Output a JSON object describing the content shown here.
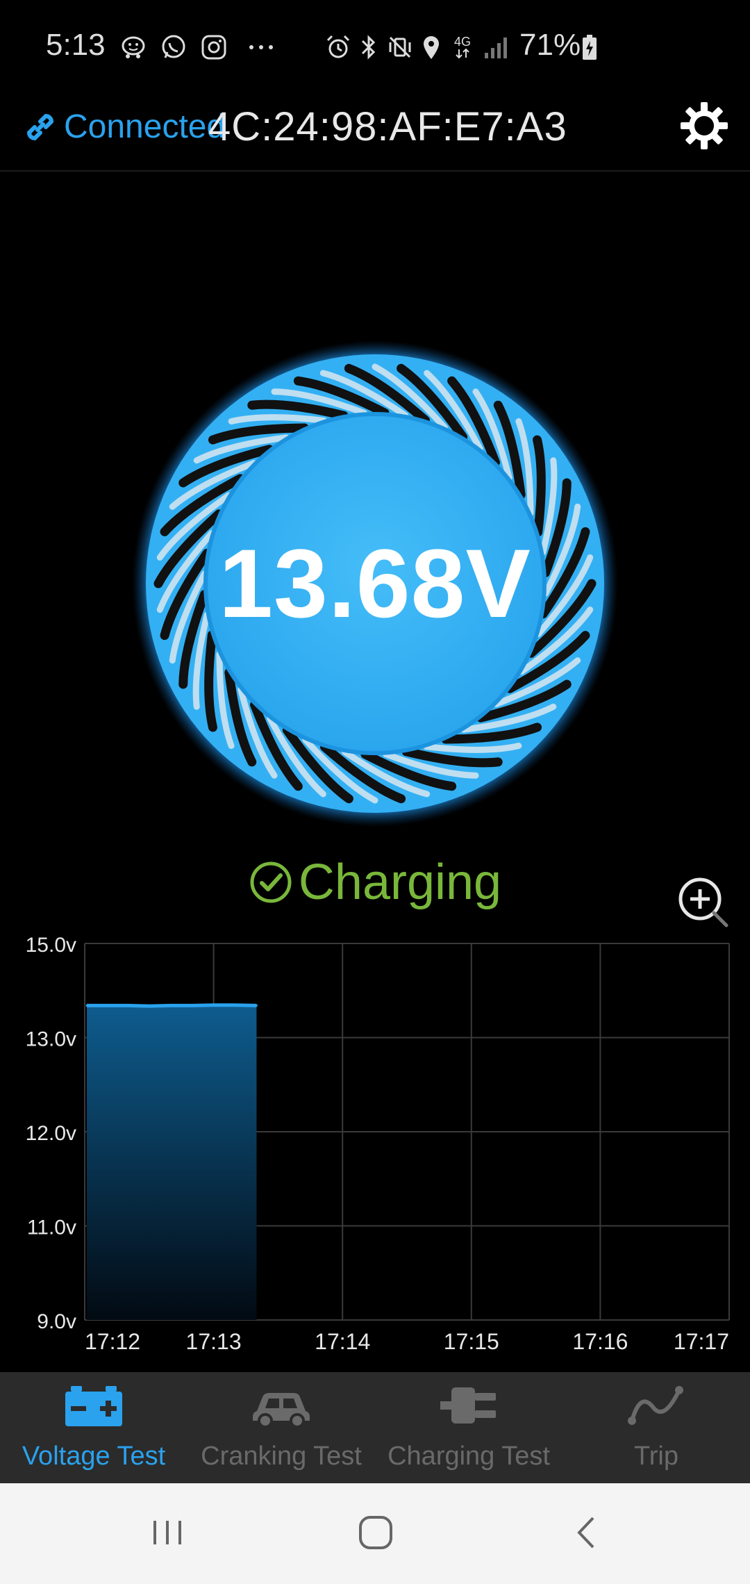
{
  "status_bar": {
    "time": "5:13",
    "battery_percent": "71%",
    "network_type": "4G"
  },
  "header": {
    "connection_status": "Connected",
    "device_address": "4C:24:98:AF:E7:A3"
  },
  "gauge": {
    "voltage_display": "13.68V"
  },
  "status": {
    "state": "Charging"
  },
  "colors": {
    "accent": "#2aa2ee",
    "charging": "#79b73a",
    "inactive_tab": "#6a6a6a"
  },
  "chart_data": {
    "type": "area",
    "y_tick_labels": [
      "15.0v",
      "13.0v",
      "12.0v",
      "11.0v",
      "9.0v"
    ],
    "x_tick_labels": [
      "17:12",
      "17:13",
      "17:14",
      "17:15",
      "17:16",
      "17:17"
    ],
    "series": [
      {
        "x": [
          "17:12:00",
          "17:12:10",
          "17:12:20",
          "17:12:30",
          "17:12:40",
          "17:12:50",
          "17:13:00",
          "17:13:10",
          "17:13:20"
        ],
        "values": [
          13.68,
          13.68,
          13.68,
          13.67,
          13.68,
          13.68,
          13.69,
          13.69,
          13.68
        ]
      }
    ],
    "grid": true
  },
  "bottom_nav": {
    "tabs": [
      {
        "label": "Voltage Test",
        "icon": "battery-icon",
        "active": true
      },
      {
        "label": "Cranking Test",
        "icon": "car-icon",
        "active": false
      },
      {
        "label": "Charging Test",
        "icon": "plug-icon",
        "active": false
      },
      {
        "label": "Trip",
        "icon": "route-icon",
        "active": false
      }
    ]
  }
}
